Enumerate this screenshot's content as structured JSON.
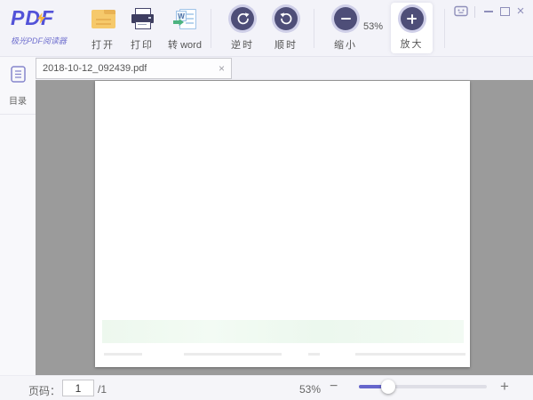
{
  "logo": {
    "title": "PDF",
    "subtitle": "极光PDF阅读器"
  },
  "toolbar": {
    "zoom_level": "53%",
    "buttons": [
      {
        "id": "open",
        "label": "打开"
      },
      {
        "id": "print",
        "label": "打印"
      },
      {
        "id": "to-word",
        "label": "转 word"
      },
      {
        "id": "rotate-ccw",
        "label": "逆时"
      },
      {
        "id": "rotate-cw",
        "label": "顺时"
      },
      {
        "id": "zoom-out",
        "label": "缩小"
      },
      {
        "id": "zoom-in",
        "label": "放大"
      }
    ],
    "word_icon_letter": "W"
  },
  "window_controls": {
    "close_glyph": "×"
  },
  "tab": {
    "title": "2018-10-12_092439.pdf",
    "close_glyph": "×"
  },
  "sidebar": {
    "toc_label": "目录"
  },
  "statusbar": {
    "page_label": "页码：",
    "page_value": "1",
    "page_total": "/1",
    "zoom_percent": "53%",
    "zoom_out_glyph": "−",
    "zoom_in_glyph": "+"
  },
  "colors": {
    "accent": "#5252d8",
    "toolbar_bg": "#f3f3f9",
    "circle_button": "#4e4e78",
    "doc_area_bg": "#9b9b9b",
    "folder_icon": "#f6c96b",
    "printer_icon": "#3e3e60",
    "word_arrow_green": "#4cb380",
    "slider_fill": "#6666cc",
    "page_highlight": "#edf8ee"
  }
}
